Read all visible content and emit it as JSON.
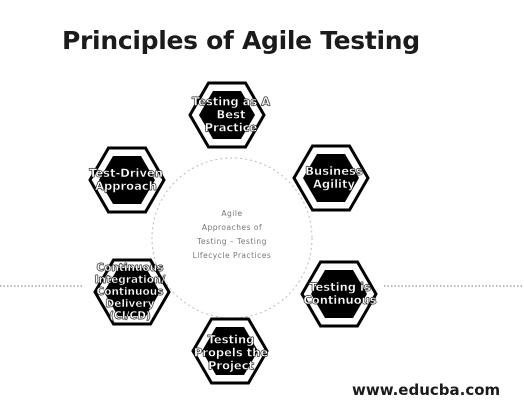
{
  "title": "Principles of Agile Testing",
  "center_text": "Agile\nApproaches of\nTesting – Testing\nLifecycle Practices",
  "footer": "www.educba.com",
  "principles": [
    "Testing as A\nBest\nPractice",
    "Business\nAgility",
    "Testing is\nContinuous",
    "Testing\nPropels the\nProject",
    "Continuous\nIntegration/\nContinuous\nDelivery\n(CI/CD)",
    "Test-Driven\nApproach"
  ],
  "colors": {
    "hex_fill": "#000000",
    "hex_ring": "#ffffff",
    "hex_border": "#000000",
    "dotted_line": "#777777"
  }
}
